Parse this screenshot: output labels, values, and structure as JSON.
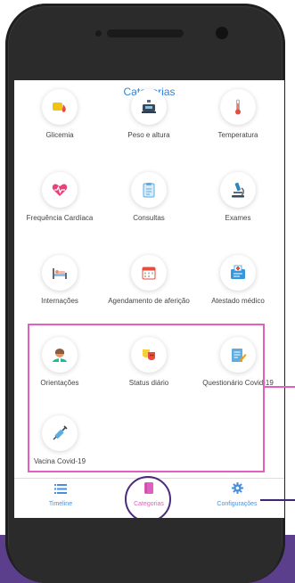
{
  "screen": {
    "title": "Categorias"
  },
  "categories": [
    {
      "label": "Glicemia",
      "icon": "glucose-drop-icon"
    },
    {
      "label": "Peso e altura",
      "icon": "scale-icon"
    },
    {
      "label": "Temperatura",
      "icon": "thermometer-icon"
    },
    {
      "label": "Frequência Cardíaca",
      "icon": "heart-rate-icon"
    },
    {
      "label": "Consultas",
      "icon": "clipboard-icon"
    },
    {
      "label": "Exames",
      "icon": "microscope-icon"
    },
    {
      "label": "Internações",
      "icon": "hospital-bed-icon"
    },
    {
      "label": "Agendamento de aferição",
      "icon": "calendar-icon"
    },
    {
      "label": "Atestado médico",
      "icon": "medical-certificate-icon"
    },
    {
      "label": "Orientações",
      "icon": "doctor-icon"
    },
    {
      "label": "Status diário",
      "icon": "mood-masks-icon"
    },
    {
      "label": "Questionário Covid-19",
      "icon": "questionnaire-icon"
    },
    {
      "label": "Vacina Covid-19",
      "icon": "syringe-icon"
    }
  ],
  "tabbar": {
    "tabs": [
      {
        "label": "Timeline",
        "icon": "list-icon"
      },
      {
        "label": "Categorias",
        "icon": "book-icon"
      },
      {
        "label": "Configurações",
        "icon": "gear-icon"
      }
    ]
  },
  "colors": {
    "accent_blue": "#2e86de",
    "highlight_pink": "#e05fbf",
    "ring_purple": "#4a2b7d",
    "background_purple": "#5b3f8c"
  }
}
